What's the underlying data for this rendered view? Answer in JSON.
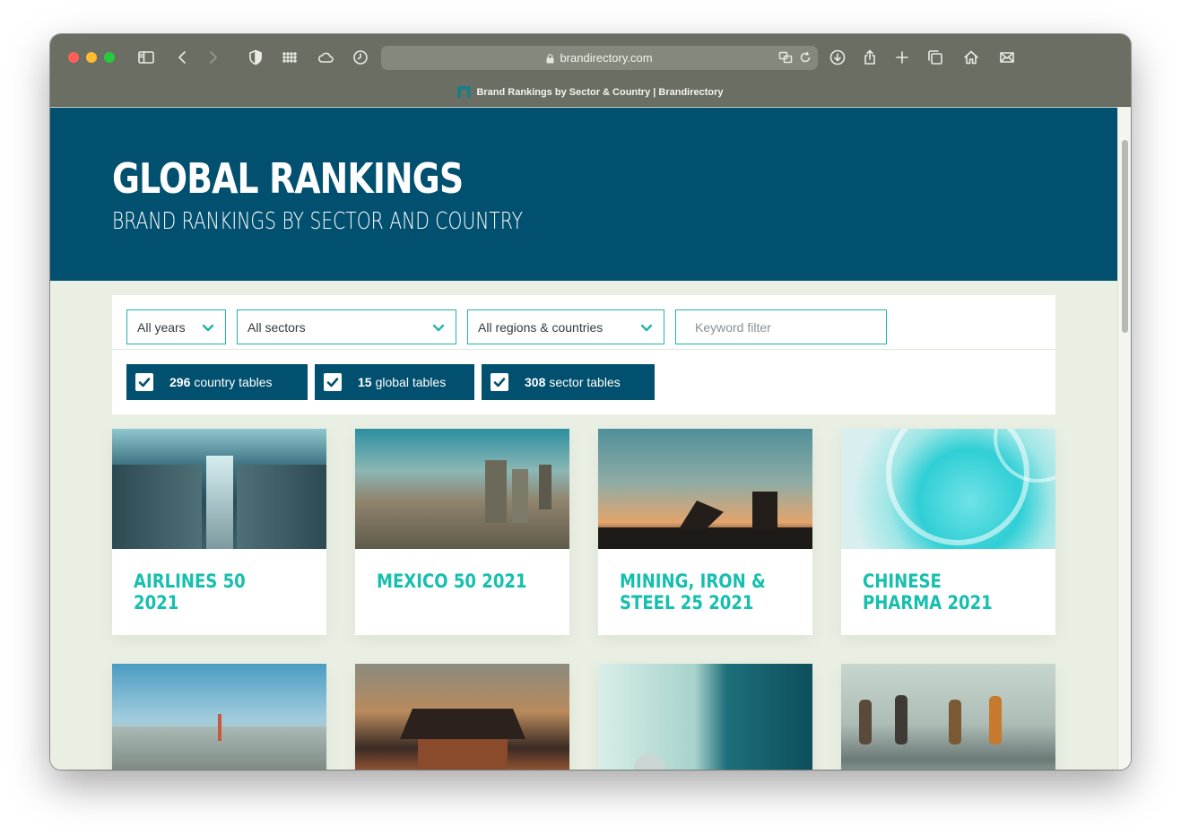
{
  "browser": {
    "url": "brandirectory.com",
    "tab_title": "Brand Rankings by Sector & Country | Brandirectory"
  },
  "hero": {
    "title": "GLOBAL RANKINGS",
    "subtitle": "BRAND RANKINGS BY SECTOR AND COUNTRY"
  },
  "filters": {
    "years": "All years",
    "sectors": "All sectors",
    "regions": "All regions & countries",
    "keyword_placeholder": "Keyword filter"
  },
  "toggles": [
    {
      "count": "296",
      "label": "country tables",
      "checked": true
    },
    {
      "count": "15",
      "label": "global tables",
      "checked": true
    },
    {
      "count": "308",
      "label": "sector tables",
      "checked": true
    }
  ],
  "cards": [
    {
      "title": "AIRLINES 50 2021",
      "image": "airplane-cabin"
    },
    {
      "title": "MEXICO 50 2021",
      "image": "city-skyline"
    },
    {
      "title": "MINING, IRON & STEEL 25 2021",
      "image": "oil-pumps-sunset"
    },
    {
      "title": "CHINESE PHARMA 2021",
      "image": "petri-dishes"
    },
    {
      "title": "",
      "image": "tokyo-skyline"
    },
    {
      "title": "",
      "image": "korean-palace"
    },
    {
      "title": "",
      "image": "hotel-bell"
    },
    {
      "title": "",
      "image": "airport-travellers"
    }
  ],
  "colors": {
    "hero_bg": "#02506f",
    "accent": "#1fb5a8",
    "card_title": "#16bfae",
    "page_bg": "#e9f0e3"
  },
  "icons": {
    "cookie": "cookie-icon"
  }
}
